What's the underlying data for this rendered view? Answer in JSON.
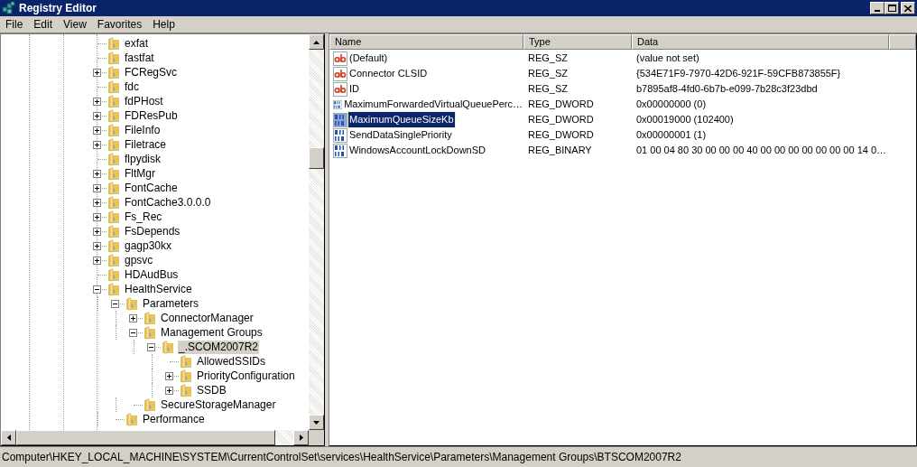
{
  "window": {
    "title": "Registry Editor"
  },
  "menu": [
    "File",
    "Edit",
    "View",
    "Favorites",
    "Help"
  ],
  "tree": [
    {
      "label": "exfat",
      "selected": false
    },
    {
      "label": "fastfat",
      "selected": false
    },
    {
      "label": "FCRegSvc",
      "expanded": false,
      "selected": false
    },
    {
      "label": "fdc",
      "selected": false
    },
    {
      "label": "fdPHost",
      "expanded": false,
      "selected": false
    },
    {
      "label": "FDResPub",
      "expanded": false,
      "selected": false
    },
    {
      "label": "FileInfo",
      "expanded": false,
      "selected": false
    },
    {
      "label": "Filetrace",
      "expanded": false,
      "selected": false
    },
    {
      "label": "flpydisk",
      "selected": false
    },
    {
      "label": "FltMgr",
      "expanded": false,
      "selected": false
    },
    {
      "label": "FontCache",
      "expanded": false,
      "selected": false
    },
    {
      "label": "FontCache3.0.0.0",
      "expanded": false,
      "selected": false
    },
    {
      "label": "Fs_Rec",
      "expanded": false,
      "selected": false
    },
    {
      "label": "FsDepends",
      "expanded": false,
      "selected": false
    },
    {
      "label": "gagp30kx",
      "expanded": false,
      "selected": false
    },
    {
      "label": "gpsvc",
      "expanded": false,
      "selected": false
    },
    {
      "label": "HDAudBus",
      "selected": false
    },
    {
      "label": "HealthService",
      "expanded": true,
      "selected": false,
      "children": [
        {
          "label": "Parameters",
          "expanded": true,
          "selected": false,
          "children": [
            {
              "label": "ConnectorManager",
              "expanded": false,
              "selected": false
            },
            {
              "label": "Management Groups",
              "expanded": true,
              "selected": false,
              "children": [
                {
                  "label": "_.SCOM2007R2",
                  "expanded": true,
                  "selected": true,
                  "children": [
                    {
                      "label": "AllowedSSIDs",
                      "selected": false
                    },
                    {
                      "label": "PriorityConfiguration",
                      "expanded": false,
                      "selected": false
                    },
                    {
                      "label": "SSDB",
                      "expanded": false,
                      "selected": false
                    }
                  ]
                }
              ]
            },
            {
              "label": "SecureStorageManager",
              "selected": false
            }
          ]
        },
        {
          "label": "Performance",
          "selected": false
        }
      ]
    }
  ],
  "values": {
    "columns": [
      "Name",
      "Type",
      "Data"
    ],
    "rows": [
      {
        "kind": "string",
        "name": "(Default)",
        "type": "REG_SZ",
        "data": "(value not set)",
        "selected": false
      },
      {
        "kind": "string",
        "name": "Connector CLSID",
        "type": "REG_SZ",
        "data": "{534E71F9-7970-42D6-921F-59CFB873855F}",
        "selected": false
      },
      {
        "kind": "string",
        "name": "ID",
        "type": "REG_SZ",
        "data": "b7895af8-4fd0-6b7b-e099-7b28c3f23dbd",
        "selected": false
      },
      {
        "kind": "binary",
        "name": "MaximumForwardedVirtualQueuePerc…",
        "type": "REG_DWORD",
        "data": "0x00000000 (0)",
        "selected": false
      },
      {
        "kind": "binary",
        "name": "MaximumQueueSizeKb",
        "type": "REG_DWORD",
        "data": "0x00019000 (102400)",
        "selected": true
      },
      {
        "kind": "binary",
        "name": "SendDataSinglePriority",
        "type": "REG_DWORD",
        "data": "0x00000001 (1)",
        "selected": false
      },
      {
        "kind": "binary",
        "name": "WindowsAccountLockDownSD",
        "type": "REG_BINARY",
        "data": "01 00 04 80 30 00 00 00 40 00 00 00 00 00 00 00 14 0…",
        "selected": false
      }
    ]
  },
  "status_bar": "Computer\\HKEY_LOCAL_MACHINE\\SYSTEM\\CurrentControlSet\\services\\HealthService\\Parameters\\Management Groups\\BTSCOM2007R2"
}
